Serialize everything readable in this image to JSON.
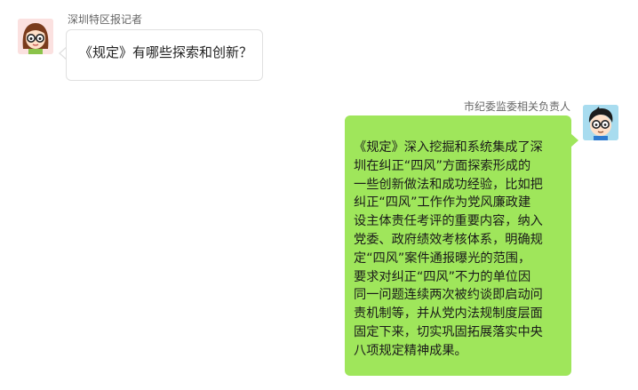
{
  "messages": [
    {
      "sender": "深圳特区报记者",
      "side": "left",
      "avatar_icon": "cartoon-girl-with-glasses-icon",
      "text": "《规定》有哪些探索和创新？"
    },
    {
      "sender": "市纪委监委相关负责人",
      "side": "right",
      "avatar_icon": "cartoon-boy-with-glasses-icon",
      "lines": [
        "《规定》深入挖掘和系统集成了深",
        "圳在纠正“四风”方面探索形成的",
        "一些创新做法和成功经验，比如把",
        "纠正“四风”工作作为党风廉政建",
        "设主体责任考评的重要内容，纳入",
        "党委、政府绩效考核体系，明确规",
        "定“四风”案件通报曝光的范围，",
        "要求对纠正“四风”不力的单位因",
        "同一问题连续两次被约谈即启动问",
        "责机制等，并从党内法规制度层面",
        "固定下来，切实巩固拓展落实中央",
        "八项规定精神成果。"
      ]
    }
  ],
  "colors": {
    "left_bubble_bg": "#ffffff",
    "left_bubble_border": "#e0e0e0",
    "right_bubble_bg": "#9fe65b",
    "sender_name": "#666666",
    "text": "#222222"
  }
}
